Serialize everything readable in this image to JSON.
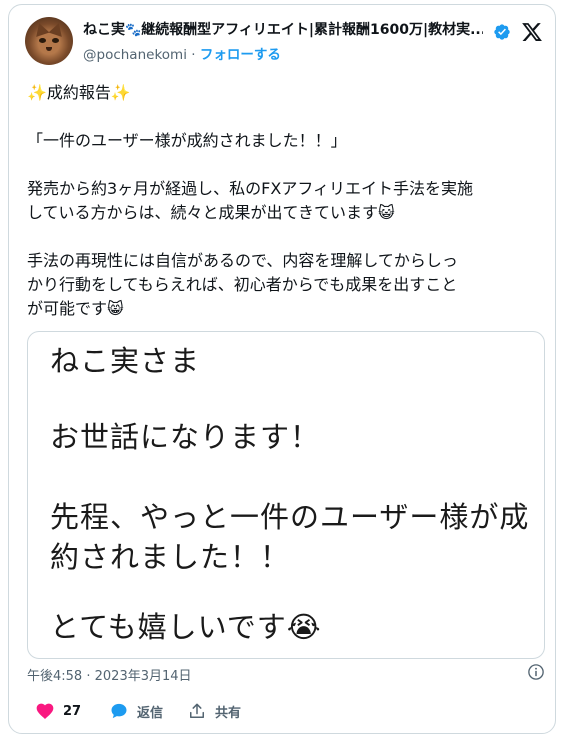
{
  "author": {
    "name": "ねこ実",
    "paw": "🐾",
    "name_rest": "継続報酬型アフィリエイト|累計報酬1600万|教材実...",
    "handle": "@pochanekomi",
    "separator": "·",
    "follow_label": "フォローする"
  },
  "tweet": {
    "line1": "✨成約報告✨",
    "line2": "「一件のユーザー様が成約されました！！」",
    "line3a": "発売から約3ヶ月が経過し、私のFXアフィリエイト手法を実施",
    "line3b": "している方からは、続々と成果が出てきています😺",
    "line4a": "手法の再現性には自信があるので、内容を理解してからしっ",
    "line4b": "かり行動をしてもらえれば、初心者からでも成果を出すこと",
    "line4c": "が可能です😸"
  },
  "media": {
    "line1": "ねこ実さま",
    "line2": "お世話になります！",
    "line3": "先程、やっと一件のユーザー様が成",
    "line4": "約されました！！",
    "line5": "とても嬉しいです😭"
  },
  "meta": {
    "time": "午後4:58",
    "sep": "·",
    "date": "2023年3月14日"
  },
  "actions": {
    "likes": "27",
    "reply": "返信",
    "share": "共有"
  },
  "icons": [
    "verified-badge-icon",
    "x-logo-icon",
    "info-icon",
    "heart-icon",
    "reply-icon",
    "share-icon"
  ],
  "colors": {
    "accent": "#1d9bf0",
    "like": "#f91880",
    "muted": "#536471"
  }
}
